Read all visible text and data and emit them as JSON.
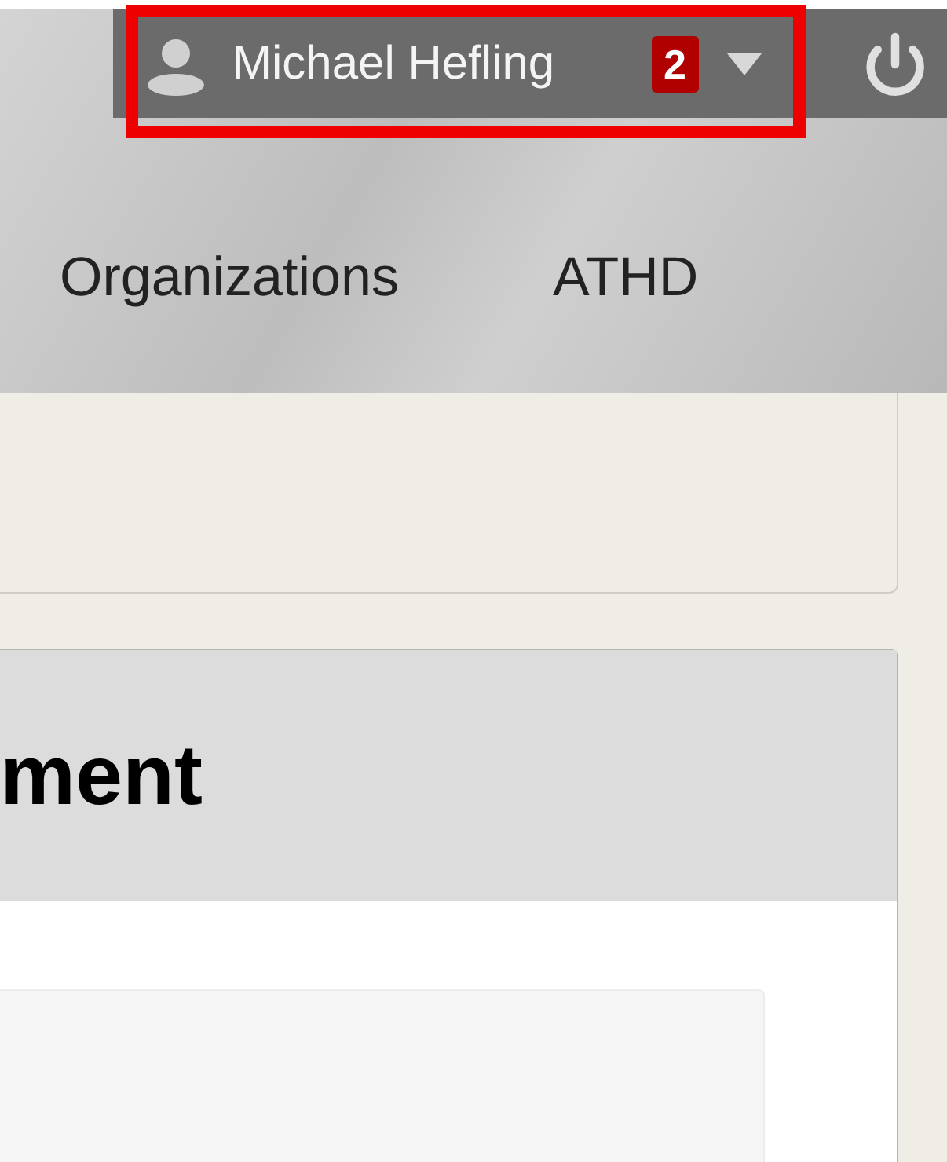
{
  "user_menu": {
    "name": "Michael Hefling",
    "badge": "2",
    "highlighted": true
  },
  "nav": [
    {
      "label": "Organizations"
    },
    {
      "label": "ATHD"
    }
  ],
  "panel": {
    "title": "ment"
  }
}
